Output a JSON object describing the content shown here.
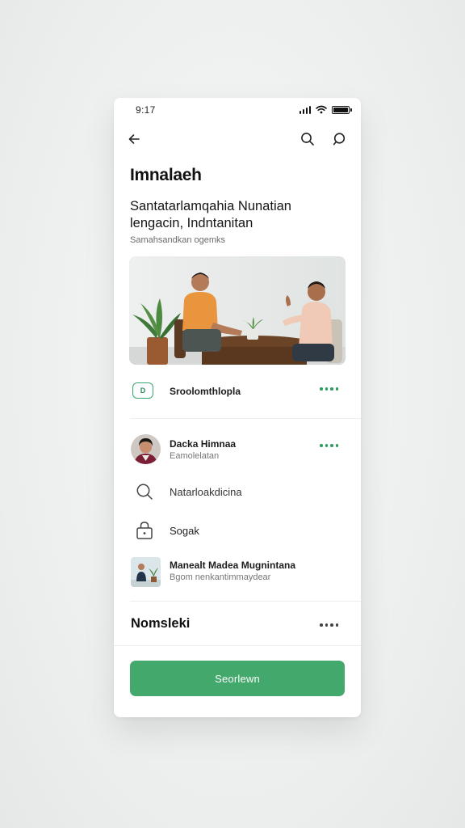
{
  "status_bar": {
    "time": "9:17"
  },
  "page": {
    "title": "Imnalaeh",
    "headline": "Santatarlamqahia Nunatian lengacin, Indntanitan",
    "subline": "Samahsandkan ogemks"
  },
  "rows": {
    "tag_row": {
      "badge": "D",
      "label": "Sroolomthlopla"
    },
    "person_row": {
      "name": "Dacka Himnaa",
      "subtitle": "Eamolelatan"
    },
    "search_row": {
      "label": "Natarloakdicina"
    },
    "lock_row": {
      "label": "Sogak"
    },
    "media_row": {
      "title": "Manealt Madea Mugnintana",
      "subtitle": "Bgom nenkantimmaydear"
    }
  },
  "section": {
    "title": "Nomsleki"
  },
  "cta": {
    "label": "Seorlewn"
  },
  "icons": {
    "back": "back-arrow-icon",
    "search": "search-icon",
    "chat": "chat-bubble-icon",
    "lock": "lock-icon",
    "more": "more-dots-icon"
  },
  "colors": {
    "accent": "#43a86b",
    "accent_dots": "#2e9c63",
    "text": "#1a1a1a",
    "muted": "#777777"
  }
}
